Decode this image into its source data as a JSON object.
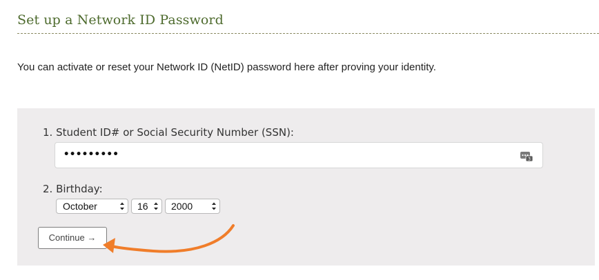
{
  "header": {
    "title": "Set up a Network ID Password"
  },
  "intro_text": "You can activate or reset your Network ID (NetID) password here after proving your identity.",
  "form": {
    "step1_label": "1. Student ID# or Social Security Number (SSN):",
    "ssn_masked_value": "•••••••••",
    "step2_label": "2. Birthday:",
    "birthday": {
      "month": "October",
      "day": "16",
      "year": "2000"
    },
    "continue_label": "Continue →"
  },
  "icons": {
    "password_field_icon": "password-manager-key-icon",
    "select_arrows": "updown-chevron-icon",
    "annotation": "orange-curved-arrow"
  },
  "colors": {
    "title": "#4e6b2e",
    "panel_bg": "#eeeced",
    "annotation_arrow": "#f07d2a"
  }
}
